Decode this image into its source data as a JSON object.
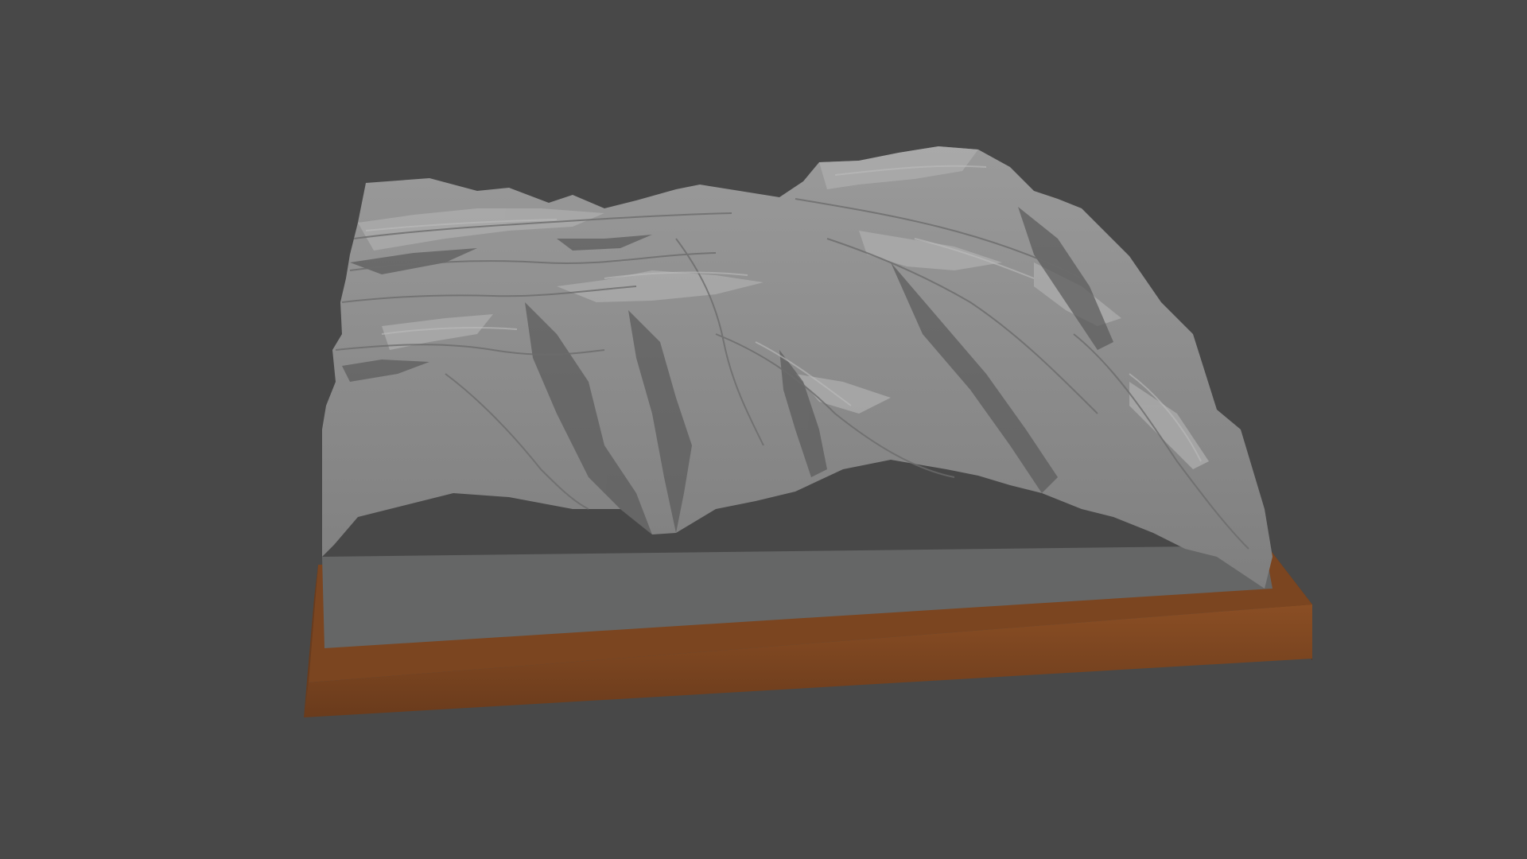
{
  "viewport": {
    "background_color": "#484848"
  },
  "scene": {
    "subject": "terrain-relief-model",
    "terrain_color": "#8e8e8e",
    "terrain_highlight_color": "#b4b4b4",
    "terrain_shadow_color": "#4a4a4a",
    "base_face_color": "#656666",
    "frame_color": "#6b3d1d",
    "frame_top_color": "#8a4e24",
    "frame_side_color": "#5a3318"
  }
}
